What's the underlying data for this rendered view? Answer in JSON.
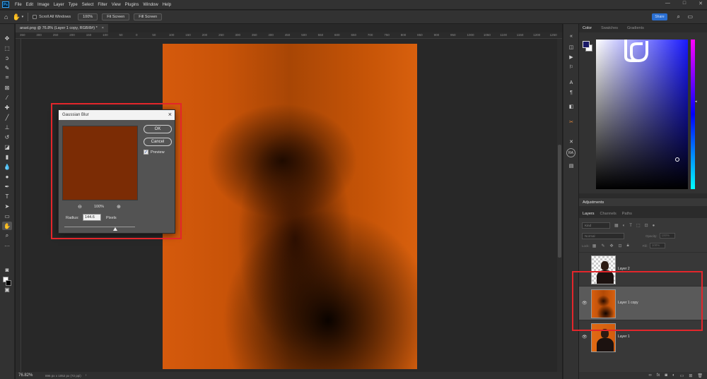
{
  "app": {
    "logo_text": "Ps",
    "menu": [
      "File",
      "Edit",
      "Image",
      "Layer",
      "Type",
      "Select",
      "Filter",
      "View",
      "Plugins",
      "Window",
      "Help"
    ],
    "window_controls": [
      "—",
      "□",
      "✕"
    ]
  },
  "options_bar": {
    "scroll_all_windows": "Scroll All Windows",
    "zoom_100": "100%",
    "fit_screen": "Fit Screen",
    "fill_screen": "Fill Screen",
    "share": "Share"
  },
  "document": {
    "tab_title": "arast.png @ 76.8% (Layer 1 copy, RGB/8#) *",
    "tab_close": "×",
    "zoom_status": "76.82%",
    "doc_info": "896 px x 1052 px (72 ppi)",
    "ruler_ticks": [
      "350",
      "300",
      "250",
      "200",
      "150",
      "100",
      "50",
      "0",
      "50",
      "100",
      "150",
      "200",
      "250",
      "300",
      "350",
      "400",
      "450",
      "500",
      "550",
      "600",
      "650",
      "700",
      "750",
      "800",
      "850",
      "900",
      "950",
      "1000",
      "1050",
      "1100",
      "1150",
      "1200",
      "1250"
    ]
  },
  "color_panel": {
    "tabs": [
      "Color",
      "Swatches",
      "Gradients"
    ],
    "foreground": "#1a1a66",
    "background": "#ffffff"
  },
  "adjustments": {
    "title": "Adjustments"
  },
  "layers_panel": {
    "tabs": [
      "Layers",
      "Channels",
      "Paths"
    ],
    "kind_placeholder": "Kind",
    "blend_mode": "Normal",
    "opacity_label": "Opacity:",
    "opacity_value": "100%",
    "lock_label": "Lock:",
    "fill_label": "Fill:",
    "fill_value": "100%",
    "layers": [
      {
        "name": "Layer 2",
        "visible": false,
        "selected": false
      },
      {
        "name": "Layer 1 copy",
        "visible": true,
        "selected": true
      },
      {
        "name": "Layer 1",
        "visible": true,
        "selected": false
      }
    ]
  },
  "gaussian_blur": {
    "title": "Gaussian Blur",
    "ok": "OK",
    "cancel": "Cancel",
    "preview_label": "Preview",
    "preview_checked": true,
    "zoom": "100%",
    "radius_label": "Radius:",
    "radius_value": "144.6",
    "radius_unit": "Pixels",
    "radius_slider_fraction": 0.72
  },
  "colors": {
    "highlight": "#e3262b",
    "ui_dark": "#323232",
    "canvas_orange": "#c85308"
  }
}
